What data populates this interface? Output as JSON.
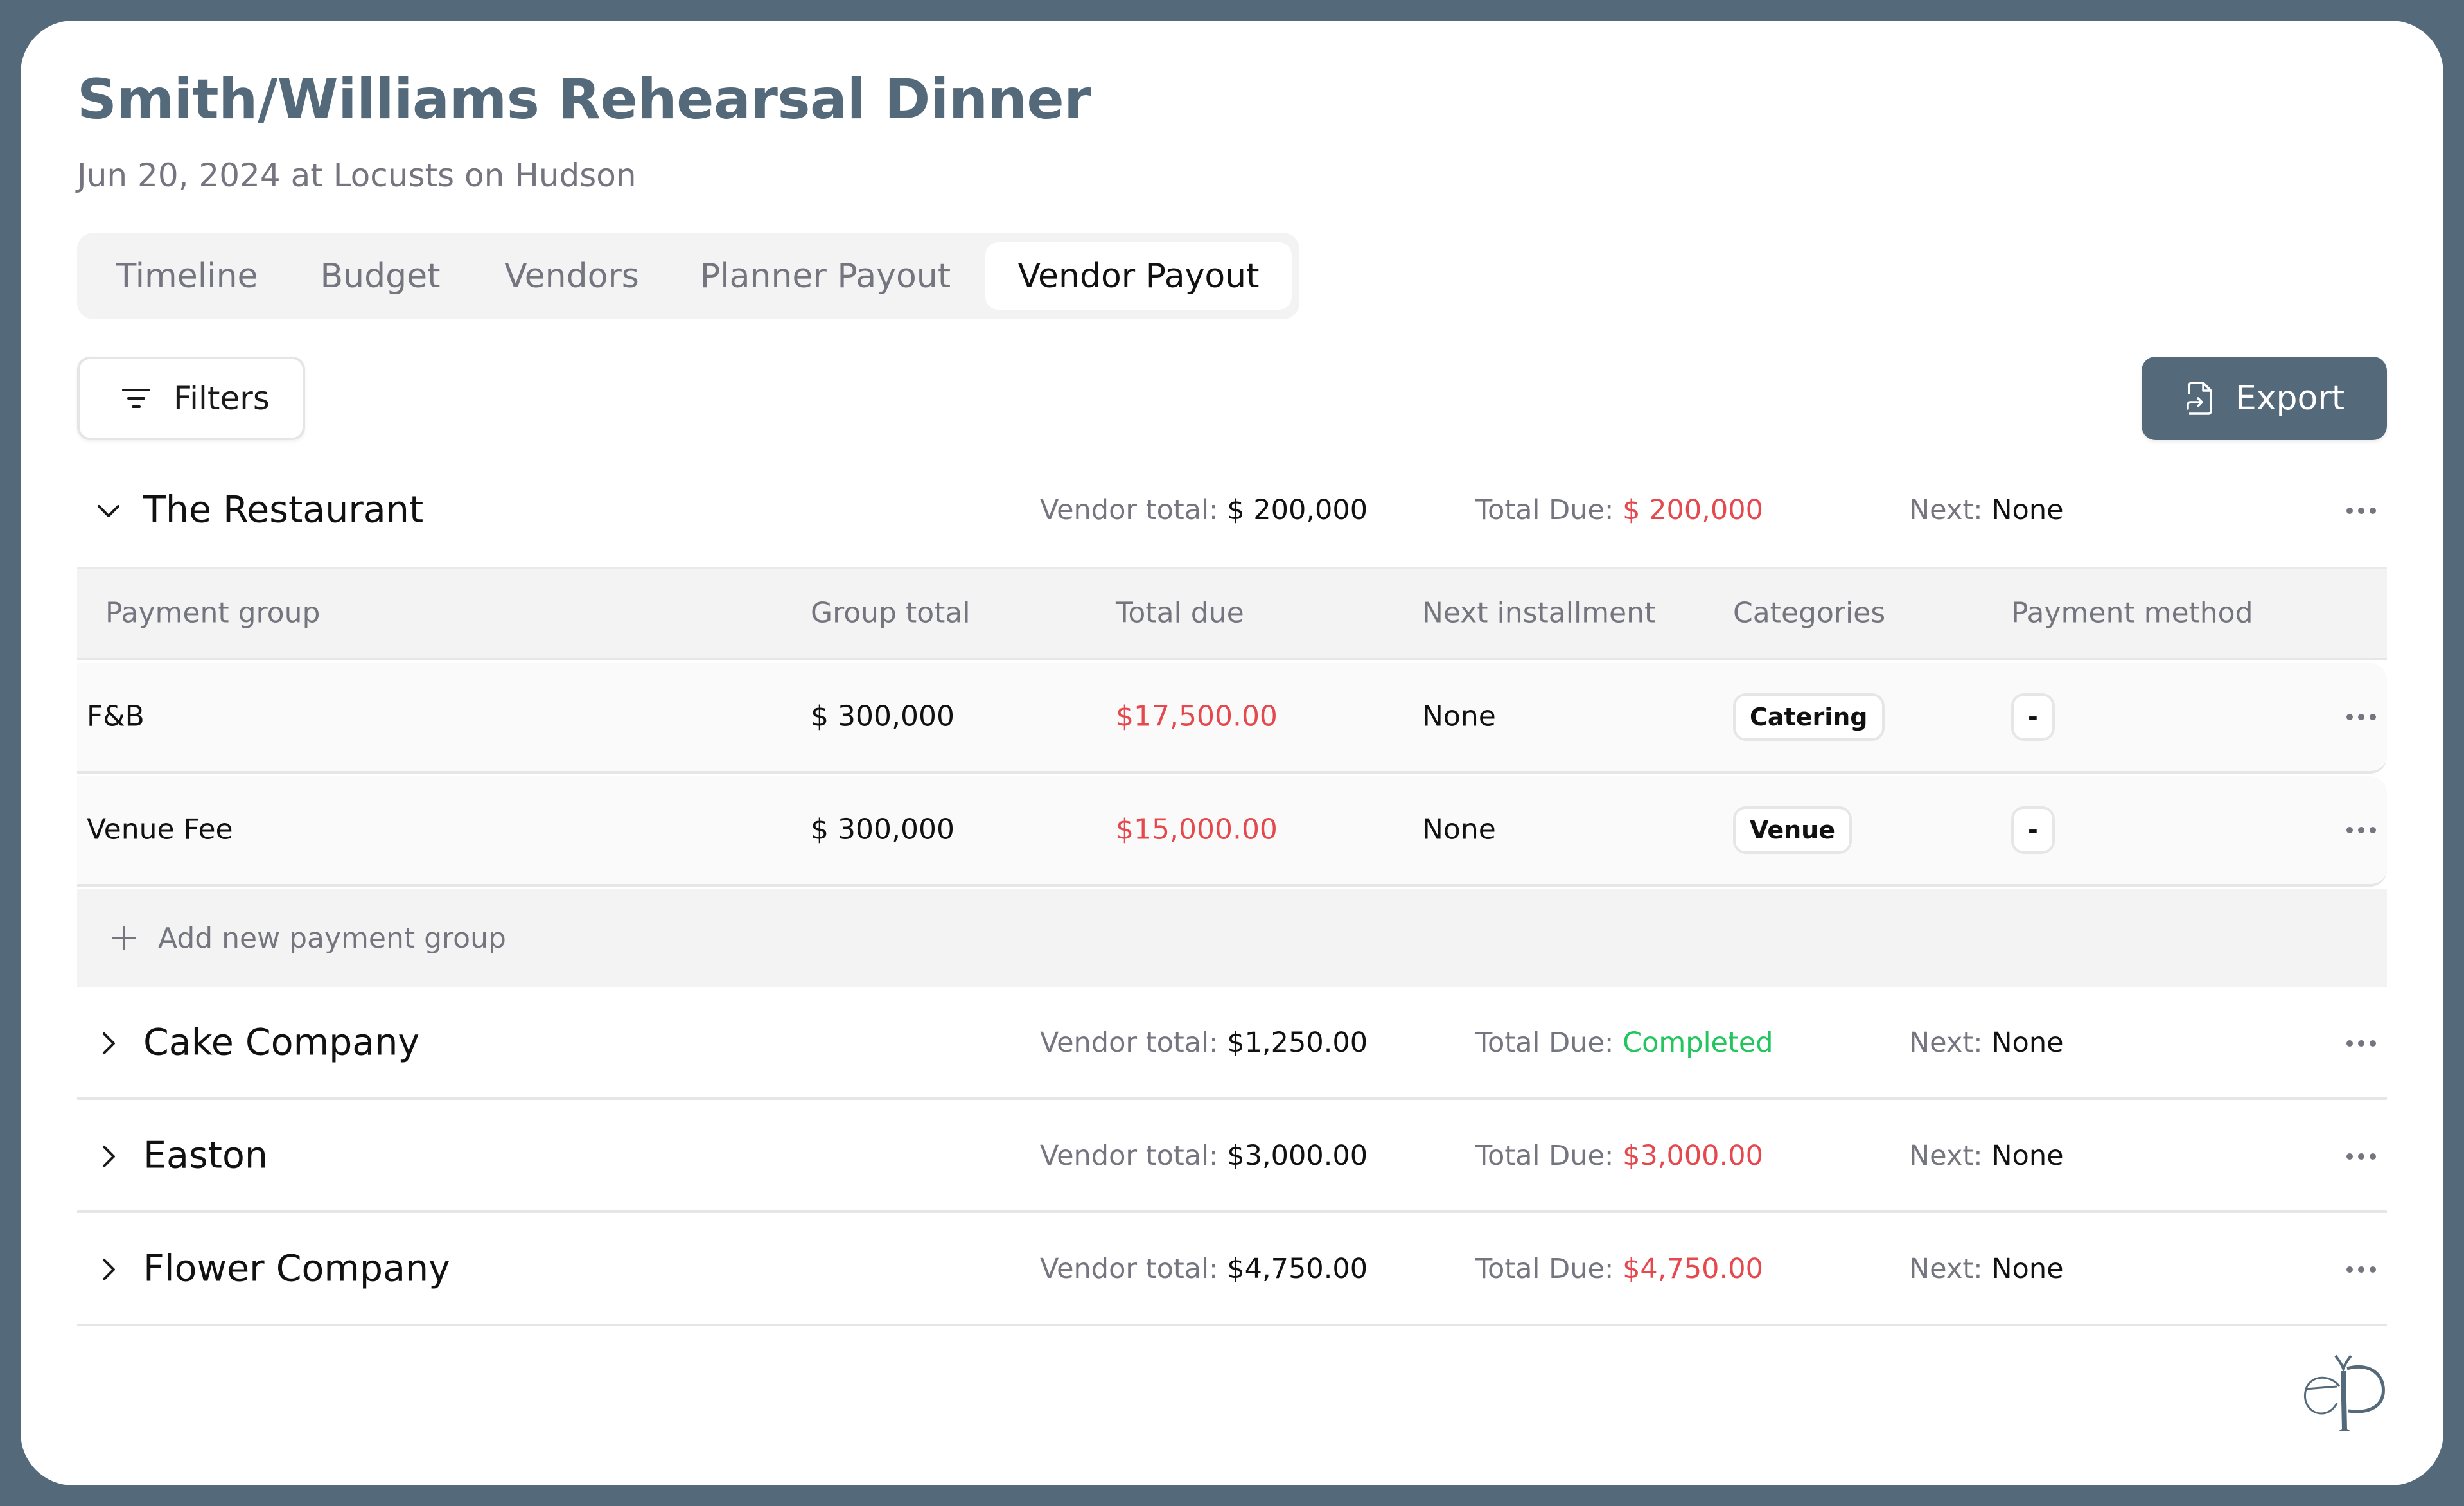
{
  "event": {
    "title": "Smith/Williams Rehearsal Dinner",
    "subtitle": "Jun 20, 2024 at Locusts on Hudson"
  },
  "tabs": [
    {
      "label": "Timeline",
      "active": false
    },
    {
      "label": "Budget",
      "active": false
    },
    {
      "label": "Vendors",
      "active": false
    },
    {
      "label": "Planner Payout",
      "active": false
    },
    {
      "label": "Vendor Payout",
      "active": true
    }
  ],
  "toolbar": {
    "filters_label": "Filters",
    "export_label": "Export",
    "filters_icon": "filter-lines-icon",
    "export_icon": "file-export-icon"
  },
  "summary_labels": {
    "vendor_total": "Vendor total:",
    "total_due": "Total Due:",
    "next": "Next:"
  },
  "vendors": [
    {
      "name": "The Restaurant",
      "expanded": true,
      "vendor_total": "$ 200,000",
      "total_due": "$ 200,000",
      "total_due_status": "due",
      "next": "None"
    },
    {
      "name": "Cake Company",
      "expanded": false,
      "vendor_total": "$1,250.00",
      "total_due": "Completed",
      "total_due_status": "completed",
      "next": "None"
    },
    {
      "name": "Easton",
      "expanded": false,
      "vendor_total": "$3,000.00",
      "total_due": "$3,000.00",
      "total_due_status": "due",
      "next": "None"
    },
    {
      "name": "Flower Company",
      "expanded": false,
      "vendor_total": "$4,750.00",
      "total_due": "$4,750.00",
      "total_due_status": "due",
      "next": "None"
    }
  ],
  "payment_table": {
    "columns": [
      "Payment group",
      "Group total",
      "Total due",
      "Next installment",
      "Categories",
      "Payment method"
    ],
    "rows": [
      {
        "group": "F&B",
        "group_total": "$ 300,000",
        "total_due": "$17,500.00",
        "next_installment": "None",
        "category": "Catering",
        "payment_method": "-"
      },
      {
        "group": "Venue Fee",
        "group_total": "$ 300,000",
        "total_due": "$15,000.00",
        "next_installment": "None",
        "category": "Venue",
        "payment_method": "-"
      }
    ],
    "add_label": "Add new payment group"
  },
  "colors": {
    "brand": "#546a7b",
    "due_red": "#e5484d",
    "completed_green": "#22c55e",
    "muted": "#75757f"
  },
  "logo": "ep-monogram-logo"
}
